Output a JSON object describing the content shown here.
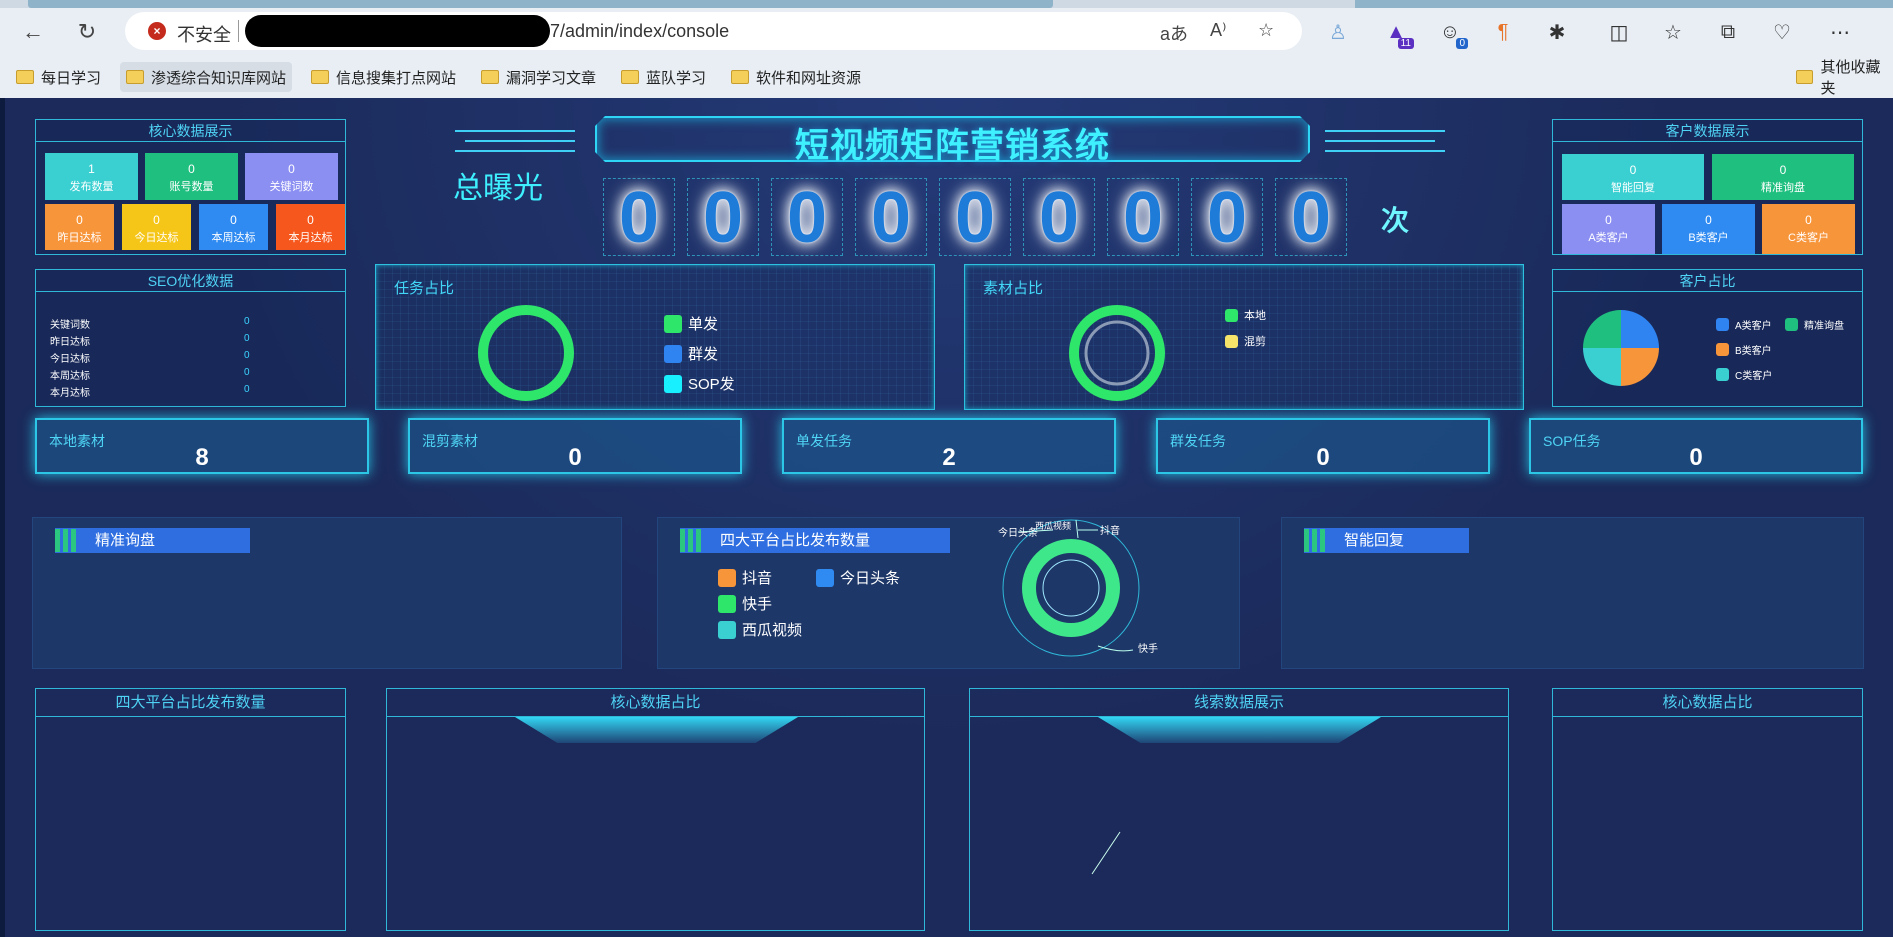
{
  "browser": {
    "insecure_label": "不安全",
    "url_tail": "7/admin/index/console",
    "ext_badges": {
      "teams": "11",
      "profile": "0"
    },
    "bookmarks": [
      "每日学习",
      "渗透综合知识库网站",
      "信息搜集打点网站",
      "漏洞学习文章",
      "蓝队学习",
      "软件和网址资源"
    ],
    "other_bookmarks": "其他收藏夹"
  },
  "header": {
    "title": "短视频矩阵营销系统",
    "exposure_label": "总曝光",
    "exposure_digits": [
      "0",
      "0",
      "0",
      "0",
      "0",
      "0",
      "0",
      "0",
      "0"
    ],
    "exposure_unit": "次"
  },
  "core": {
    "title": "核心数据展示",
    "tiles": [
      {
        "value": "1",
        "label": "发布数量",
        "color": "#3ad0d2"
      },
      {
        "value": "0",
        "label": "账号数量",
        "color": "#1fbf7f"
      },
      {
        "value": "0",
        "label": "关键词数",
        "color": "#8c8ff2"
      },
      {
        "value": "0",
        "label": "昨日达标",
        "color": "#f7953b"
      },
      {
        "value": "0",
        "label": "今日达标",
        "color": "#f5c518"
      },
      {
        "value": "0",
        "label": "本周达标",
        "color": "#2f8bf2"
      },
      {
        "value": "0",
        "label": "本月达标",
        "color": "#f5571c"
      }
    ]
  },
  "customer": {
    "title": "客户数据展示",
    "tiles": [
      {
        "value": "0",
        "label": "智能回复",
        "color": "#3ad0d2"
      },
      {
        "value": "0",
        "label": "精准询盘",
        "color": "#1fbf7f"
      },
      {
        "value": "0",
        "label": "A类客户",
        "color": "#8c8ff2"
      },
      {
        "value": "0",
        "label": "B类客户",
        "color": "#2f8bf2"
      },
      {
        "value": "0",
        "label": "C类客户",
        "color": "#f7953b"
      }
    ]
  },
  "seo": {
    "title": "SEO优化数据",
    "rows": [
      {
        "label": "关键词数",
        "value": "0"
      },
      {
        "label": "昨日达标",
        "value": "0"
      },
      {
        "label": "今日达标",
        "value": "0"
      },
      {
        "label": "本周达标",
        "value": "0"
      },
      {
        "label": "本月达标",
        "value": "0"
      }
    ]
  },
  "task_ratio": {
    "title": "任务占比",
    "legend": [
      {
        "label": "单发",
        "color": "#2ee66a"
      },
      {
        "label": "群发",
        "color": "#2f84f2"
      },
      {
        "label": "SOP发",
        "color": "#19f0ff"
      }
    ]
  },
  "material_ratio": {
    "title": "素材占比",
    "legend": [
      {
        "label": "本地",
        "color": "#2ee66a"
      },
      {
        "label": "混剪",
        "color": "#f6e36a"
      }
    ]
  },
  "customer_ratio": {
    "title": "客户占比",
    "legend": [
      {
        "label": "A类客户",
        "color": "#2f84f2"
      },
      {
        "label": "精准询盘",
        "color": "#1fbf7f"
      },
      {
        "label": "B类客户",
        "color": "#f7953b"
      },
      {
        "label": "C类客户",
        "color": "#3ad0d2"
      }
    ]
  },
  "stats": [
    {
      "label": "本地素材",
      "value": "8"
    },
    {
      "label": "混剪素材",
      "value": "0"
    },
    {
      "label": "单发任务",
      "value": "2"
    },
    {
      "label": "群发任务",
      "value": "0"
    },
    {
      "label": "SOP任务",
      "value": "0"
    }
  ],
  "bottom_panels": {
    "inquiry": "精准询盘",
    "platform": "四大平台占比发布数量",
    "smart_reply": "智能回复",
    "platform_legend": [
      {
        "label": "抖音",
        "color": "#f7953b"
      },
      {
        "label": "今日头条",
        "color": "#2f8bf2"
      },
      {
        "label": "快手",
        "color": "#2ee66a"
      },
      {
        "label": "西瓜视频",
        "color": "#3ad0d2"
      }
    ],
    "ring_labels": {
      "toutiao": "今日头条",
      "xigua": "西瓜视频",
      "douyin": "抖音",
      "kuaishou": "快手"
    }
  },
  "lower_panels": [
    "四大平台占比发布数量",
    "核心数据占比",
    "线索数据展示",
    "核心数据占比"
  ]
}
